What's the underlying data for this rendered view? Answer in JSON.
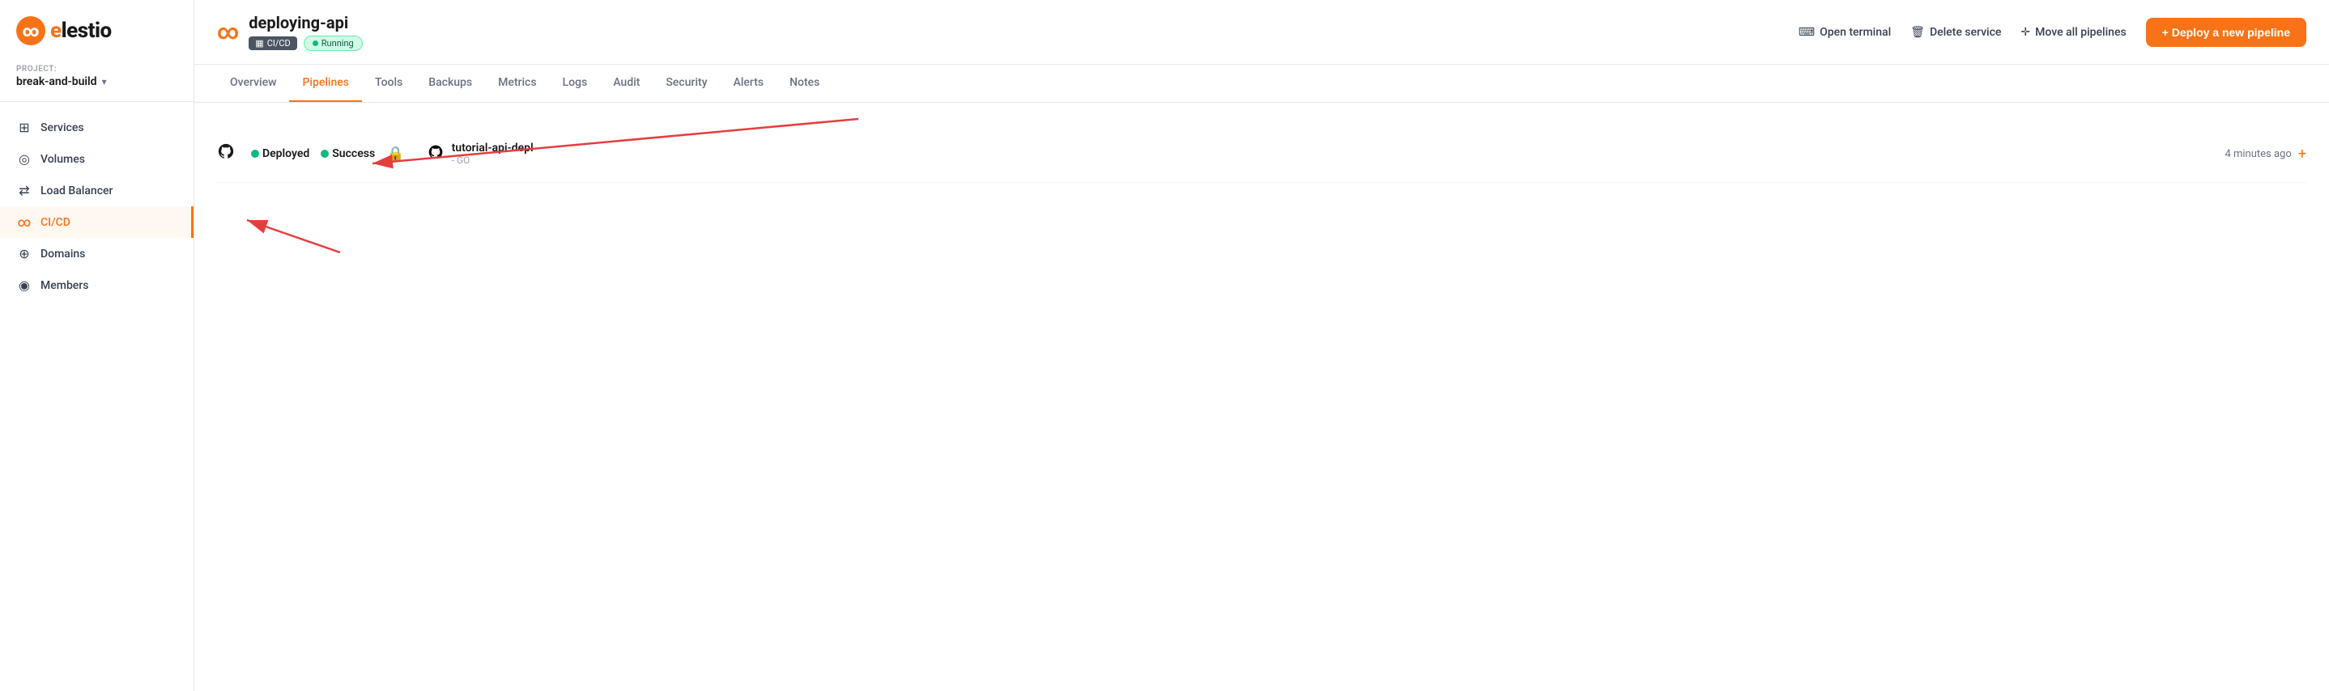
{
  "sidebar": {
    "logo": "elestio",
    "project_label": "PROJECT:",
    "project_name": "break-and-build",
    "items": [
      {
        "id": "services",
        "label": "Services",
        "icon": "☰",
        "active": false
      },
      {
        "id": "volumes",
        "label": "Volumes",
        "icon": "◎",
        "active": false
      },
      {
        "id": "load-balancer",
        "label": "Load Balancer",
        "icon": "⇄",
        "active": false
      },
      {
        "id": "cicd",
        "label": "CI/CD",
        "icon": "∞",
        "active": true
      },
      {
        "id": "domains",
        "label": "Domains",
        "icon": "⊕",
        "active": false
      },
      {
        "id": "members",
        "label": "Members",
        "icon": "◉",
        "active": false
      }
    ]
  },
  "header": {
    "service_name": "deploying-api",
    "badge_cicd": "CI/CD",
    "badge_running": "Running",
    "actions": [
      {
        "id": "open-terminal",
        "label": "Open terminal",
        "icon": ">_"
      },
      {
        "id": "delete-service",
        "label": "Delete service",
        "icon": "🗑"
      },
      {
        "id": "move-pipelines",
        "label": "Move all pipelines",
        "icon": "✛"
      }
    ],
    "deploy_button": "+ Deploy a new pipeline"
  },
  "tabs": [
    {
      "id": "overview",
      "label": "Overview",
      "active": false
    },
    {
      "id": "pipelines",
      "label": "Pipelines",
      "active": true
    },
    {
      "id": "tools",
      "label": "Tools",
      "active": false
    },
    {
      "id": "backups",
      "label": "Backups",
      "active": false
    },
    {
      "id": "metrics",
      "label": "Metrics",
      "active": false
    },
    {
      "id": "logs",
      "label": "Logs",
      "active": false
    },
    {
      "id": "audit",
      "label": "Audit",
      "active": false
    },
    {
      "id": "security",
      "label": "Security",
      "active": false
    },
    {
      "id": "alerts",
      "label": "Alerts",
      "active": false
    },
    {
      "id": "notes",
      "label": "Notes",
      "active": false
    }
  ],
  "pipeline": {
    "status_deployed": "Deployed",
    "status_success": "Success",
    "name": "tutorial-api-depl",
    "lang": "- GO",
    "time": "4 minutes ago"
  }
}
